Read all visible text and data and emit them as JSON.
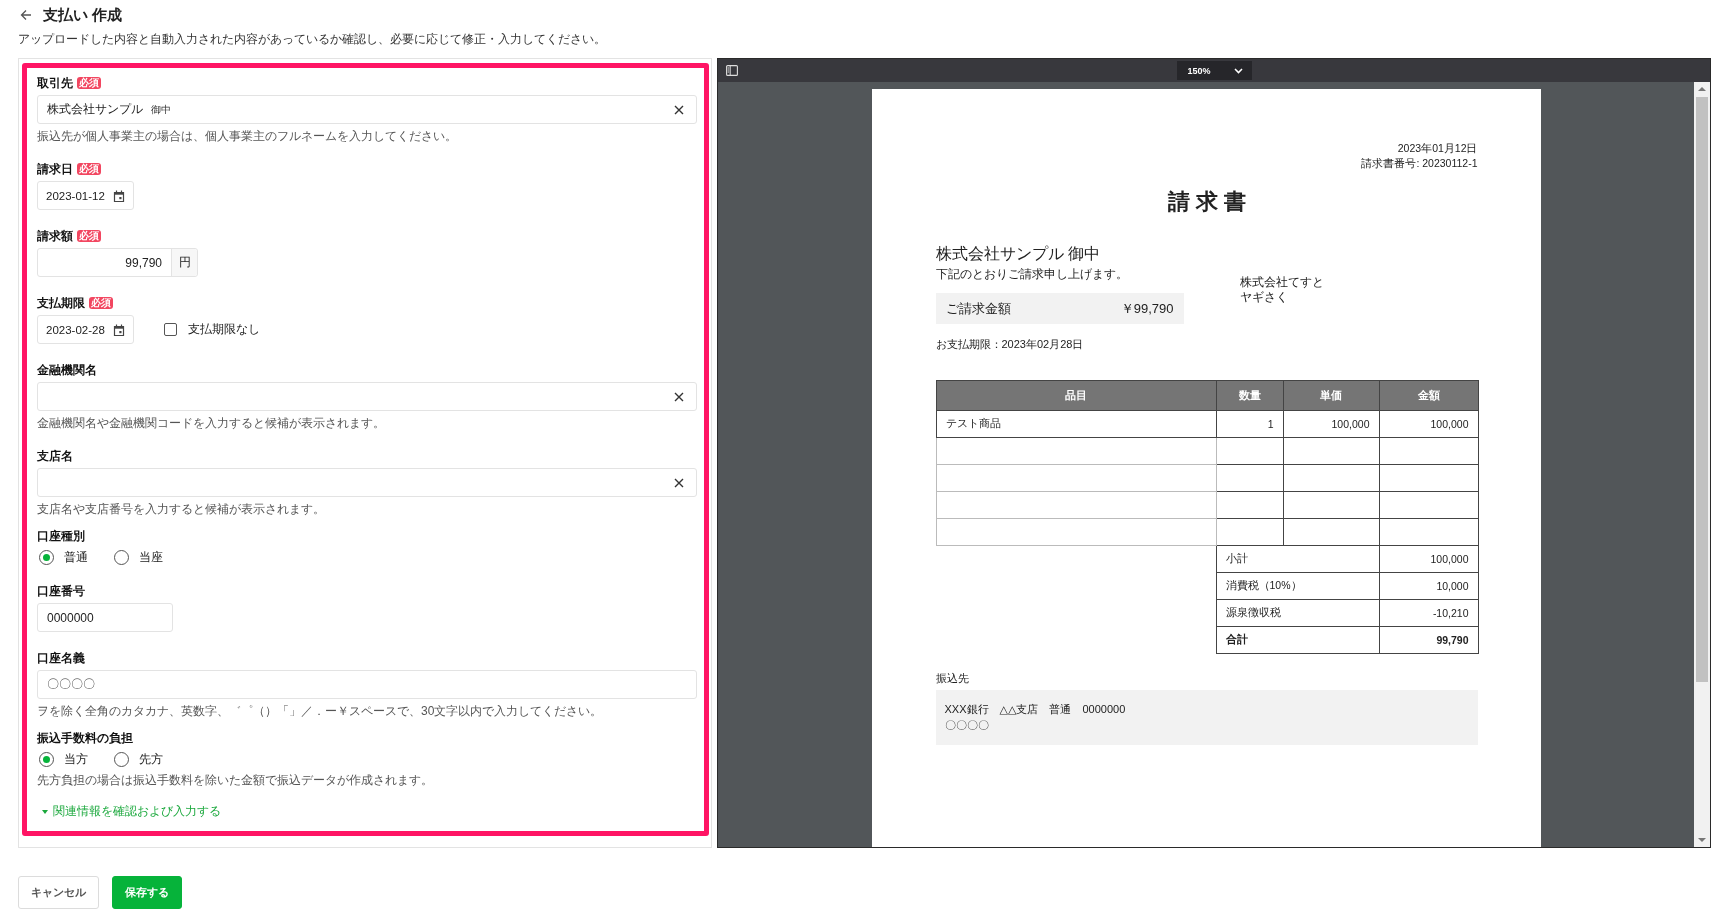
{
  "header": {
    "title": "支払い 作成",
    "description": "アップロードした内容と自動入力された内容があっているか確認し、必要に応じて修正・入力してください。"
  },
  "form": {
    "fields": [
      {
        "kind": "text",
        "label": "取引先",
        "badge": "必須",
        "value": "株式会社サンプル",
        "value_note": "御中",
        "clearable": true,
        "hint": "振込先が個人事業主の場合は、個人事業主のフルネームを入力してください。"
      },
      {
        "kind": "date",
        "label": "請求日",
        "badge": "必須",
        "value": "2023-01-12"
      },
      {
        "kind": "amount",
        "label": "請求額",
        "badge": "必須",
        "value": "99,790",
        "unit": "円"
      },
      {
        "kind": "date",
        "label": "支払期限",
        "badge": "必須",
        "value": "2023-02-28",
        "checkbox": {
          "label": "支払期限なし",
          "checked": false
        }
      },
      {
        "kind": "text",
        "label": "金融機関名",
        "clearable": true,
        "hint": "金融機関名や金融機関コードを入力すると候補が表示されます。"
      },
      {
        "kind": "text",
        "label": "支店名",
        "clearable": true,
        "hint": "支店名や支店番号を入力すると候補が表示されます。"
      },
      {
        "kind": "radio",
        "label": "口座種別",
        "options": [
          {
            "label": "普通",
            "selected": true
          },
          {
            "label": "当座",
            "selected": false
          }
        ]
      },
      {
        "kind": "number",
        "label": "口座番号",
        "value": "0000000"
      },
      {
        "kind": "text",
        "label": "口座名義",
        "value": "〇〇〇〇",
        "clearable": false,
        "hint": "ヲを除く全角のカタカナ、英数字、゛゜（）「」／．ー￥スペースで、30文字以内で入力してください。"
      },
      {
        "kind": "radio",
        "label": "振込手数料の負担",
        "options": [
          {
            "label": "当方",
            "selected": true
          },
          {
            "label": "先方",
            "selected": false
          }
        ],
        "hint": "先方負担の場合は振込手数料を除いた金額で振込データが作成されます。"
      }
    ],
    "expand_link": {
      "label": "関連情報を確認および入力する",
      "expanded": false
    }
  },
  "actions": [
    {
      "kind": "secondary",
      "label": "キャンセル"
    },
    {
      "kind": "primary",
      "label": "保存する"
    }
  ],
  "preview": {
    "zoom": "150%",
    "document": {
      "date": "2023年01月12日",
      "number": "請求書番号: 20230112-1",
      "title": "請求書",
      "recipient": "株式会社サンプル 御中",
      "intro": "下記のとおりご請求申し上げます。",
      "amount_label": "ご請求金額",
      "amount": "￥99,790",
      "issuer": [
        "株式会社てすと",
        "ヤギさく"
      ],
      "due": "お支払期限：2023年02月28日",
      "table": {
        "columns": [
          "品目",
          "数量",
          "単価",
          "金額"
        ],
        "rows": [
          {
            "kind": "item",
            "cells": [
              "テスト商品",
              "1",
              "100,000",
              "100,000"
            ]
          },
          {
            "kind": "blank"
          },
          {
            "kind": "blank"
          },
          {
            "kind": "blank"
          },
          {
            "kind": "blank"
          }
        ],
        "summary": [
          {
            "kind": "line",
            "label": "小計",
            "value": "100,000"
          },
          {
            "kind": "line",
            "label": "消費税（10%）",
            "value": "10,000"
          },
          {
            "kind": "line",
            "label": "源泉徴収税",
            "value": "-10,210"
          },
          {
            "kind": "total",
            "label": "合計",
            "value": "99,790"
          }
        ]
      },
      "transfer_label": "振込先",
      "transfer_lines": [
        "XXX銀行　△△支店　普通　0000000",
        "〇〇〇〇"
      ]
    }
  }
}
